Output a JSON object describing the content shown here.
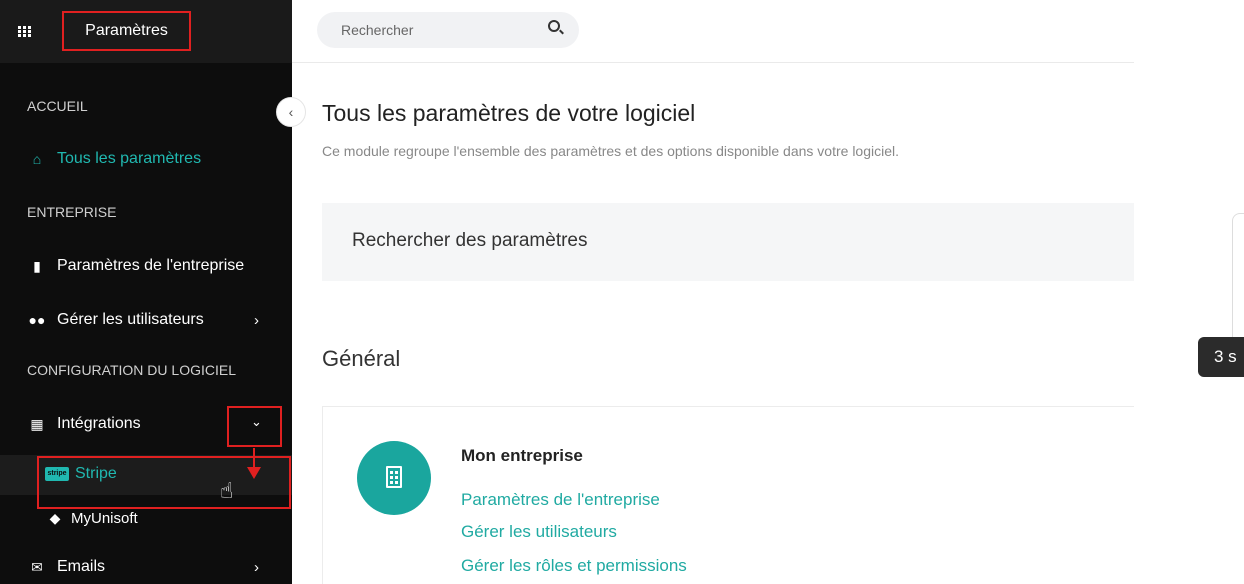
{
  "header": {
    "app_title": "Paramètres",
    "search_placeholder": "Rechercher"
  },
  "sidebar": {
    "sections": [
      {
        "label": "ACCUEIL"
      },
      {
        "label": "ENTREPRISE"
      },
      {
        "label": "CONFIGURATION DU LOGICIEL"
      }
    ],
    "items": [
      {
        "label": "Tous les paramètres",
        "icon": "home-icon",
        "active": true
      },
      {
        "label": "Paramètres de l'entreprise",
        "icon": "building-icon"
      },
      {
        "label": "Gérer les utilisateurs",
        "icon": "users-icon",
        "expandable": true
      },
      {
        "label": "Intégrations",
        "icon": "grid-icon",
        "expanded": true
      },
      {
        "label": "Stripe",
        "icon": "stripe-icon",
        "sub": true,
        "badge": "stripe"
      },
      {
        "label": "MyUnisoft",
        "icon": "myunisoft-icon",
        "sub": true
      },
      {
        "label": "Emails",
        "icon": "mail-icon",
        "expandable": true
      }
    ],
    "accent": "#20b8b0"
  },
  "main": {
    "title": "Tous les paramètres de votre logiciel",
    "subtitle": "Ce module regroupe l'ensemble des paramètres et des options disponible dans votre logiciel.",
    "param_search_label": "Rechercher des paramètres",
    "section_title": "Général",
    "card": {
      "title": "Mon entreprise",
      "links": [
        "Paramètres de l'entreprise",
        "Gérer les utilisateurs",
        "Gérer les rôles et permissions"
      ]
    }
  },
  "tooltip": {
    "text": "3 s"
  },
  "colors": {
    "link": "#20aaa2",
    "annotation": "#e02020",
    "circle": "#1aa69e"
  }
}
